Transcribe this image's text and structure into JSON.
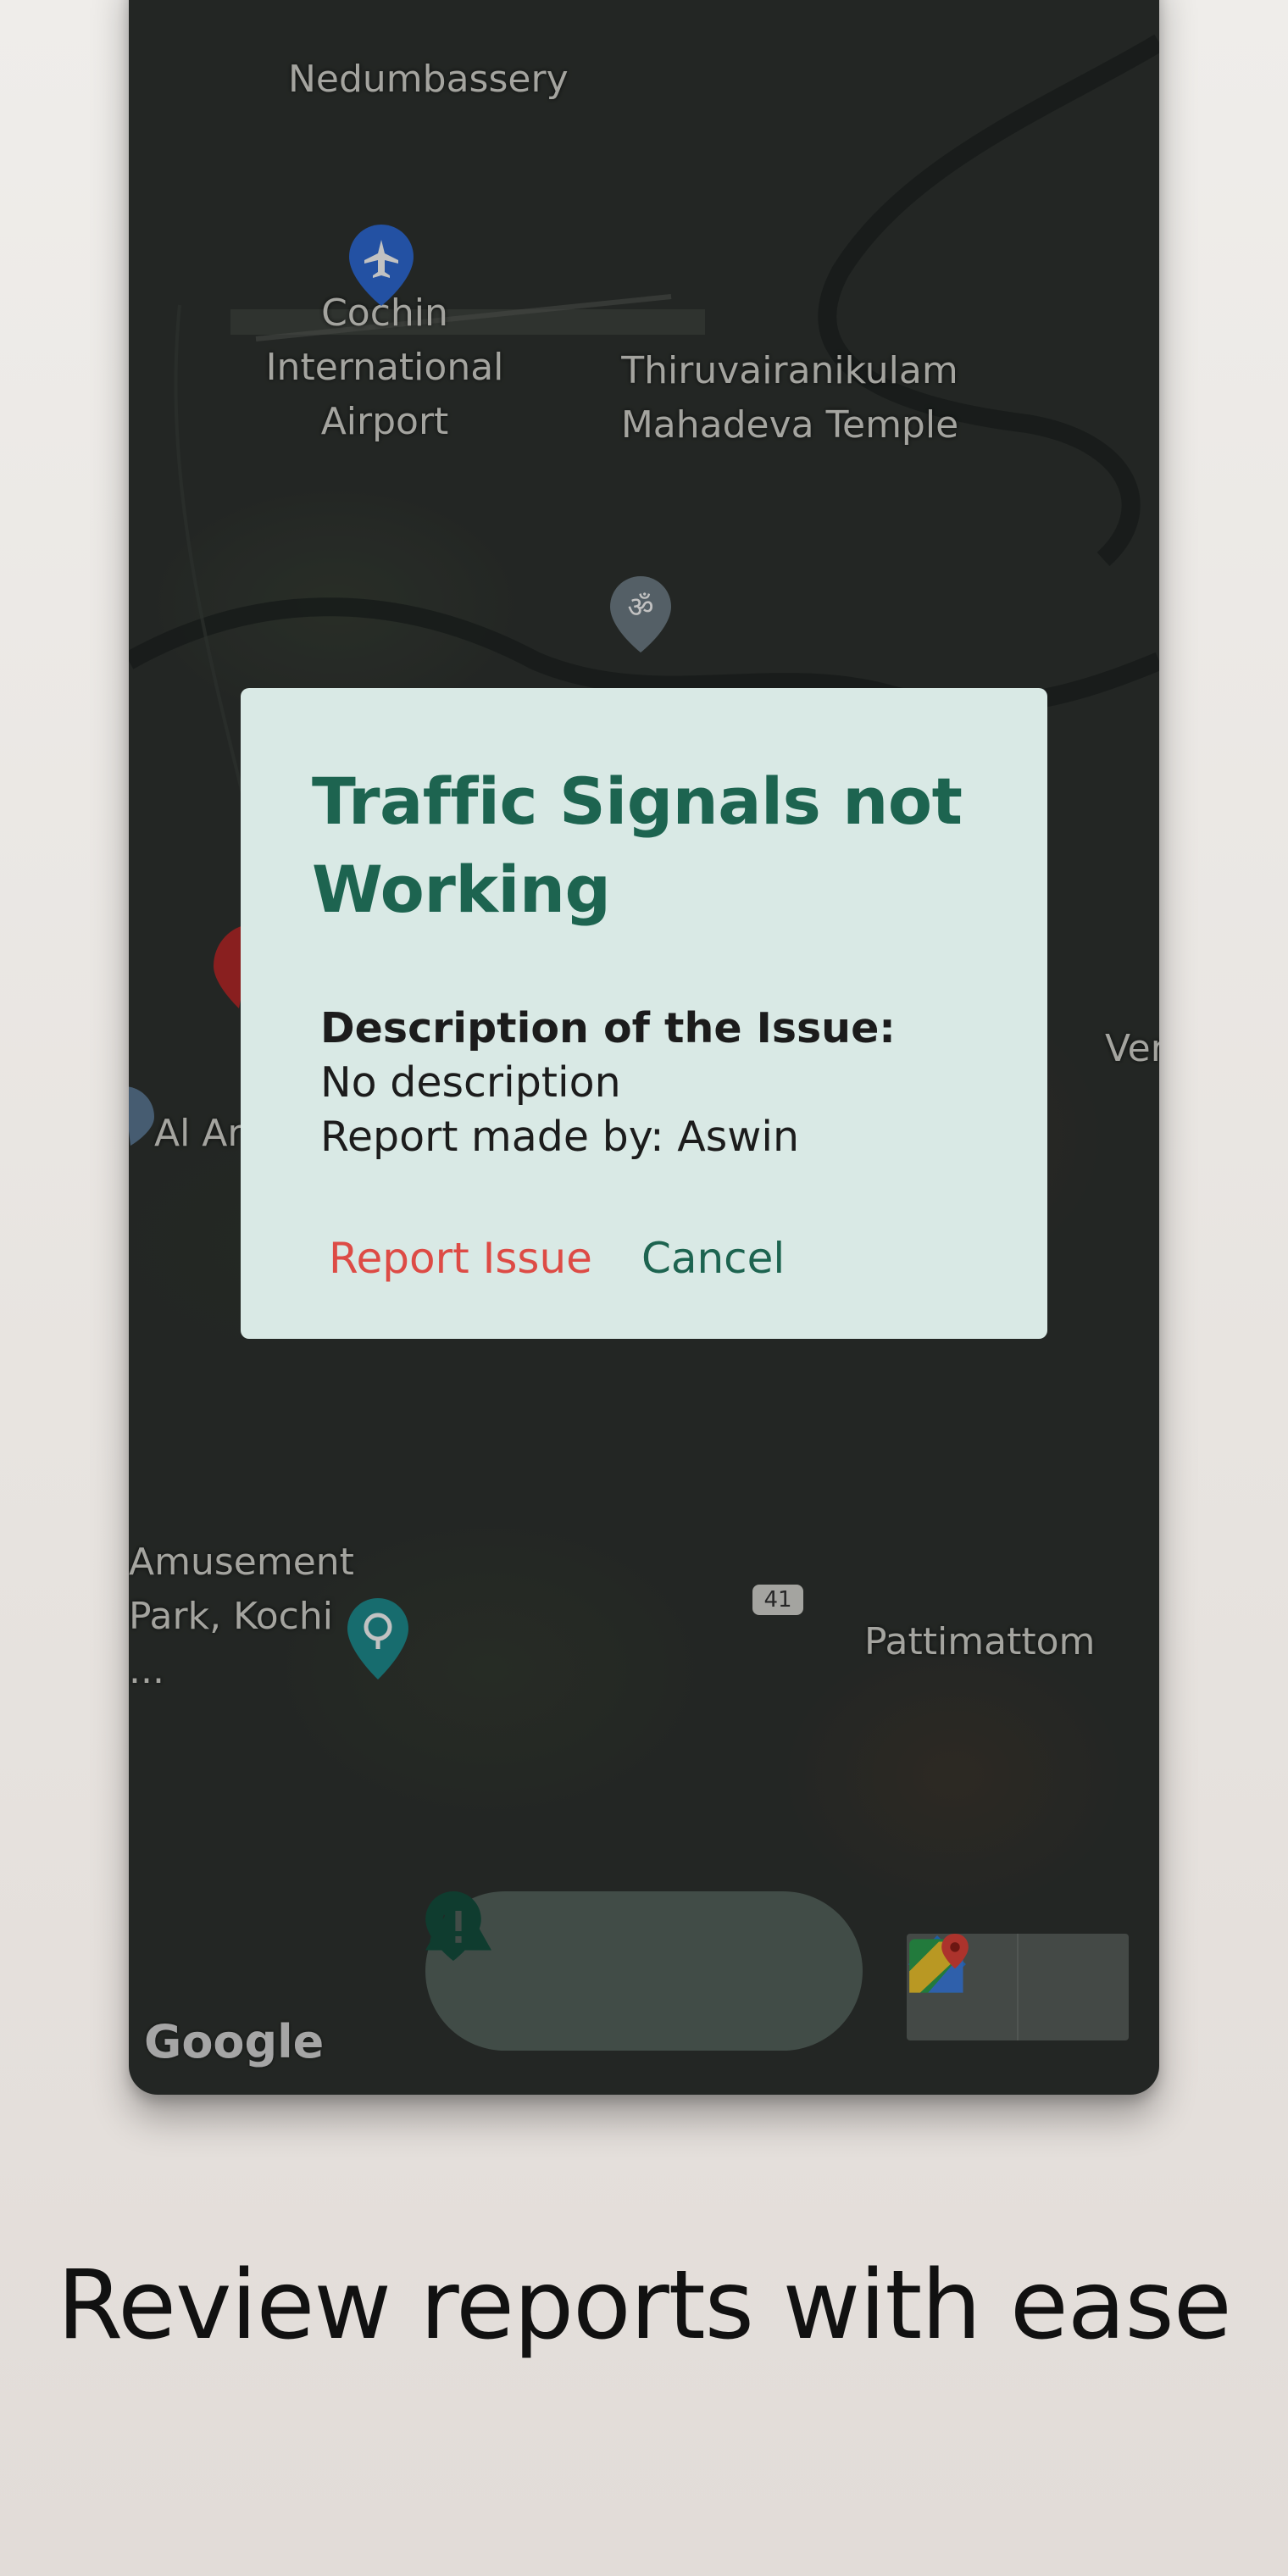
{
  "map": {
    "labels": {
      "nedumbassery": "Nedumbassery",
      "airport": "Cochin\nInternational\nAirport",
      "temple": "Thiruvairanikulam\nMahadeva Temple",
      "amusement": "Amusement\nPark, Kochi\n...",
      "pattimattom": "Pattimattom",
      "al_ar": "Al Ar",
      "ver": "Ver",
      "road_number": "41"
    },
    "attribution": "Google"
  },
  "dialog": {
    "title": "Traffic Signals not Working",
    "description_label": "Description of the Issue:",
    "description_value": "No description",
    "reporter_line": "Report made by: Aswin",
    "report_button": "Report Issue",
    "cancel_button": "Cancel"
  },
  "bottom_nav": {
    "items": [
      {
        "icon": "location-pin-icon"
      },
      {
        "icon": "person-icon"
      },
      {
        "icon": "warning-icon"
      }
    ]
  },
  "map_buttons": [
    {
      "icon": "directions-icon"
    },
    {
      "icon": "google-maps-icon"
    }
  ],
  "colors": {
    "accent": "#1d6450",
    "danger": "#dd4b45",
    "dialog_bg": "#d9e9e5"
  },
  "tagline": "Review reports with ease"
}
